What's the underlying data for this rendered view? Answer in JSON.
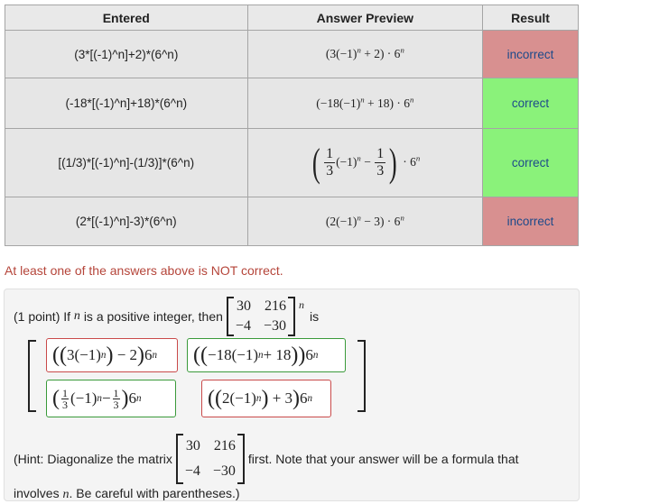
{
  "table": {
    "headers": [
      "Entered",
      "Answer Preview",
      "Result"
    ],
    "rows": [
      {
        "entered": "(3*[(-1)^n]+2)*(6^n)",
        "result": "incorrect"
      },
      {
        "entered": "(-18*[(-1)^n]+18)*(6^n)",
        "result": "correct"
      },
      {
        "entered": "[(1/3)*[(-1)^n]-(1/3)]*(6^n)",
        "result": "correct"
      },
      {
        "entered": "(2*[(-1)^n]-3)*(6^n)",
        "result": "incorrect"
      }
    ]
  },
  "warning": "At least one of the answers above is NOT correct.",
  "problem": {
    "prefix": "(1 point) If",
    "var": "n",
    "mid": "is a positive integer, then",
    "suffix": "is",
    "matrix": [
      "30",
      "216",
      "−4",
      "−30"
    ],
    "hint_a": "(Hint: Diagonalize the matrix",
    "hint_b": "first. Note that your answer will be a formula that",
    "hint_c": "involves",
    "hint_d": ". Be careful with parentheses.)"
  },
  "colors": {
    "incorrect": "#d89090",
    "correct": "#8af27a",
    "warning": "#b5453a"
  }
}
